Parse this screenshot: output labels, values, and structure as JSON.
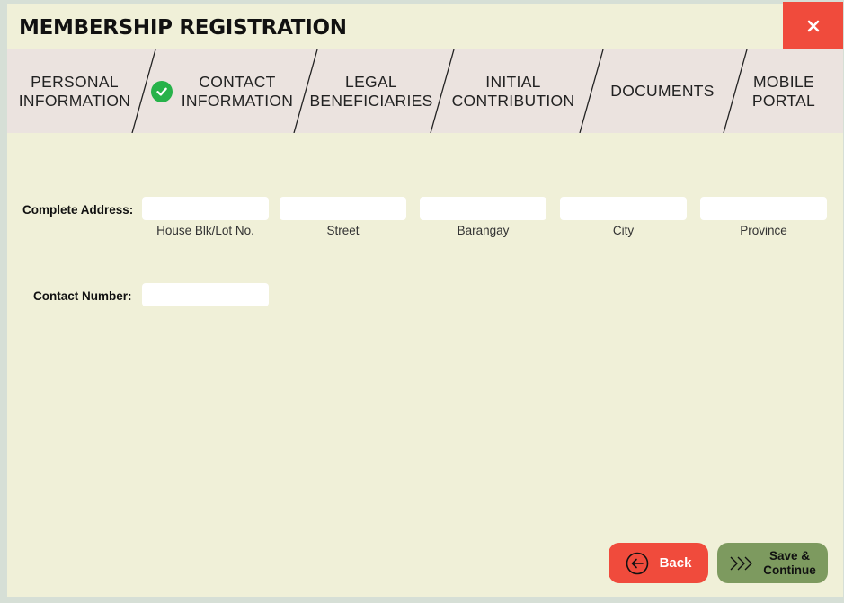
{
  "window": {
    "title": "MEMBERSHIP REGISTRATION",
    "close_icon": "close-icon"
  },
  "tabs": [
    {
      "label": "PERSONAL\nINFORMATION",
      "completed": false
    },
    {
      "label": "CONTACT\nINFORMATION",
      "completed": true,
      "icon": "check-circle-icon"
    },
    {
      "label": "LEGAL\nBENEFICIARIES",
      "completed": false
    },
    {
      "label": "INITIAL\nCONTRIBUTION",
      "completed": false
    },
    {
      "label": "DOCUMENTS",
      "completed": false
    },
    {
      "label": "MOBILE\nPORTAL",
      "completed": false
    }
  ],
  "form": {
    "address_label": "Complete Address:",
    "address_fields": [
      {
        "caption": "House Blk/Lot No.",
        "value": ""
      },
      {
        "caption": "Street",
        "value": ""
      },
      {
        "caption": "Barangay",
        "value": ""
      },
      {
        "caption": "City",
        "value": ""
      },
      {
        "caption": "Province",
        "value": ""
      }
    ],
    "contact_label": "Contact Number:",
    "contact_value": ""
  },
  "buttons": {
    "back_label": "Back",
    "back_icon": "arrow-left-circle-icon",
    "save_label": "Save &\nContinue",
    "save_icon": "triple-chevron-right-icon"
  },
  "colors": {
    "background": "#f0f0d8",
    "tab_bar": "#ebe3df",
    "accent_red": "#f04b3c",
    "save_green": "#7d9a5f",
    "check_green": "#27b24a"
  }
}
